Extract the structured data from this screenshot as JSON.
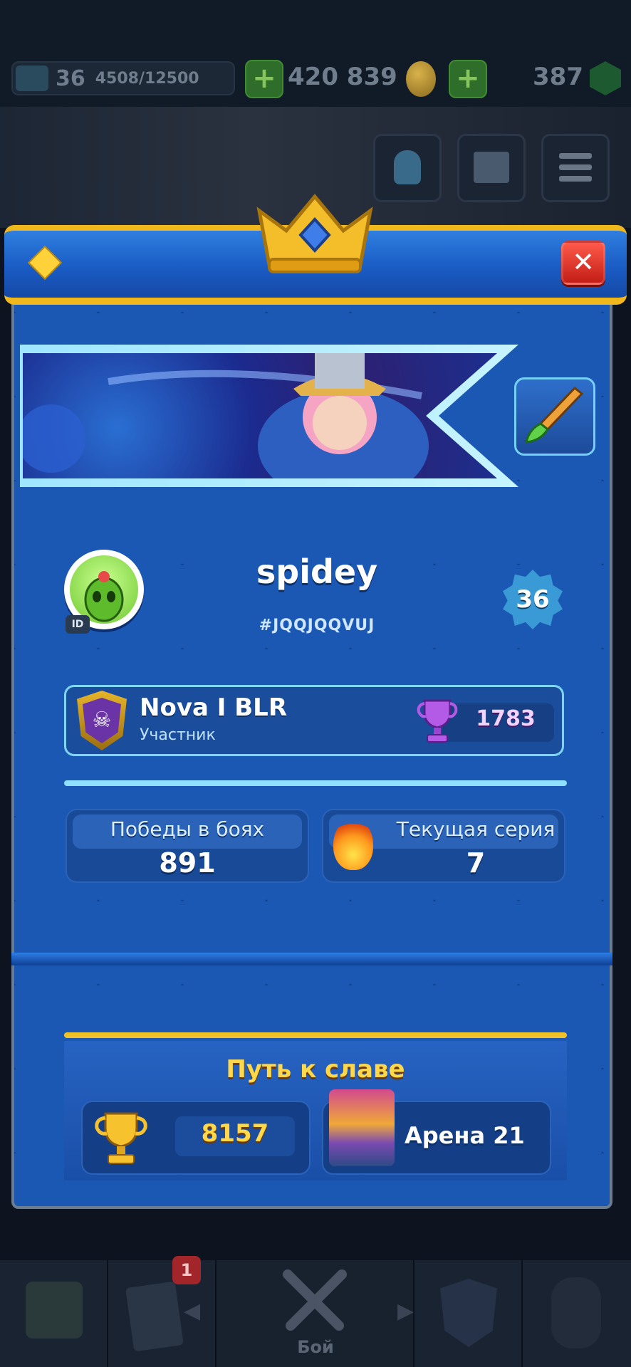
{
  "topbar": {
    "level": "36",
    "xp": "4508/12500",
    "gold": "420 839",
    "gems": "387",
    "plus_label": "+"
  },
  "header": {
    "close_label": "✕"
  },
  "profile": {
    "name": "spidey",
    "tag": "#JQQJQQVUJ",
    "id_label": "ID",
    "level": "36"
  },
  "clan": {
    "name": "Nova I BLR",
    "role": "Участник",
    "trophies": "1783"
  },
  "stats": [
    {
      "label": "Победы в боях",
      "value": "891"
    },
    {
      "label": "Текущая серия",
      "value": "7"
    }
  ],
  "glory": {
    "title": "Путь к славе",
    "trophies": "8157",
    "arena": "Арена 21"
  },
  "bottomnav": {
    "cards_badge": "1",
    "battle_label": "Бой"
  }
}
